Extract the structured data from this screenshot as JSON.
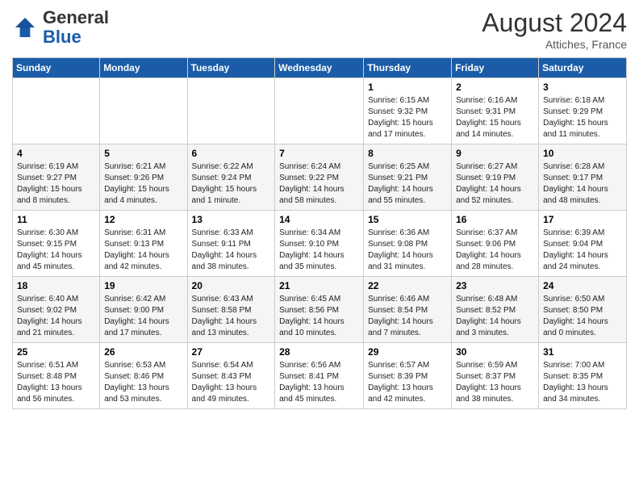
{
  "logo": {
    "general": "General",
    "blue": "Blue"
  },
  "title": "August 2024",
  "location": "Attiches, France",
  "weekdays": [
    "Sunday",
    "Monday",
    "Tuesday",
    "Wednesday",
    "Thursday",
    "Friday",
    "Saturday"
  ],
  "weeks": [
    [
      {
        "day": "",
        "info": ""
      },
      {
        "day": "",
        "info": ""
      },
      {
        "day": "",
        "info": ""
      },
      {
        "day": "",
        "info": ""
      },
      {
        "day": "1",
        "info": "Sunrise: 6:15 AM\nSunset: 9:32 PM\nDaylight: 15 hours\nand 17 minutes."
      },
      {
        "day": "2",
        "info": "Sunrise: 6:16 AM\nSunset: 9:31 PM\nDaylight: 15 hours\nand 14 minutes."
      },
      {
        "day": "3",
        "info": "Sunrise: 6:18 AM\nSunset: 9:29 PM\nDaylight: 15 hours\nand 11 minutes."
      }
    ],
    [
      {
        "day": "4",
        "info": "Sunrise: 6:19 AM\nSunset: 9:27 PM\nDaylight: 15 hours\nand 8 minutes."
      },
      {
        "day": "5",
        "info": "Sunrise: 6:21 AM\nSunset: 9:26 PM\nDaylight: 15 hours\nand 4 minutes."
      },
      {
        "day": "6",
        "info": "Sunrise: 6:22 AM\nSunset: 9:24 PM\nDaylight: 15 hours\nand 1 minute."
      },
      {
        "day": "7",
        "info": "Sunrise: 6:24 AM\nSunset: 9:22 PM\nDaylight: 14 hours\nand 58 minutes."
      },
      {
        "day": "8",
        "info": "Sunrise: 6:25 AM\nSunset: 9:21 PM\nDaylight: 14 hours\nand 55 minutes."
      },
      {
        "day": "9",
        "info": "Sunrise: 6:27 AM\nSunset: 9:19 PM\nDaylight: 14 hours\nand 52 minutes."
      },
      {
        "day": "10",
        "info": "Sunrise: 6:28 AM\nSunset: 9:17 PM\nDaylight: 14 hours\nand 48 minutes."
      }
    ],
    [
      {
        "day": "11",
        "info": "Sunrise: 6:30 AM\nSunset: 9:15 PM\nDaylight: 14 hours\nand 45 minutes."
      },
      {
        "day": "12",
        "info": "Sunrise: 6:31 AM\nSunset: 9:13 PM\nDaylight: 14 hours\nand 42 minutes."
      },
      {
        "day": "13",
        "info": "Sunrise: 6:33 AM\nSunset: 9:11 PM\nDaylight: 14 hours\nand 38 minutes."
      },
      {
        "day": "14",
        "info": "Sunrise: 6:34 AM\nSunset: 9:10 PM\nDaylight: 14 hours\nand 35 minutes."
      },
      {
        "day": "15",
        "info": "Sunrise: 6:36 AM\nSunset: 9:08 PM\nDaylight: 14 hours\nand 31 minutes."
      },
      {
        "day": "16",
        "info": "Sunrise: 6:37 AM\nSunset: 9:06 PM\nDaylight: 14 hours\nand 28 minutes."
      },
      {
        "day": "17",
        "info": "Sunrise: 6:39 AM\nSunset: 9:04 PM\nDaylight: 14 hours\nand 24 minutes."
      }
    ],
    [
      {
        "day": "18",
        "info": "Sunrise: 6:40 AM\nSunset: 9:02 PM\nDaylight: 14 hours\nand 21 minutes."
      },
      {
        "day": "19",
        "info": "Sunrise: 6:42 AM\nSunset: 9:00 PM\nDaylight: 14 hours\nand 17 minutes."
      },
      {
        "day": "20",
        "info": "Sunrise: 6:43 AM\nSunset: 8:58 PM\nDaylight: 14 hours\nand 13 minutes."
      },
      {
        "day": "21",
        "info": "Sunrise: 6:45 AM\nSunset: 8:56 PM\nDaylight: 14 hours\nand 10 minutes."
      },
      {
        "day": "22",
        "info": "Sunrise: 6:46 AM\nSunset: 8:54 PM\nDaylight: 14 hours\nand 7 minutes."
      },
      {
        "day": "23",
        "info": "Sunrise: 6:48 AM\nSunset: 8:52 PM\nDaylight: 14 hours\nand 3 minutes."
      },
      {
        "day": "24",
        "info": "Sunrise: 6:50 AM\nSunset: 8:50 PM\nDaylight: 14 hours\nand 0 minutes."
      }
    ],
    [
      {
        "day": "25",
        "info": "Sunrise: 6:51 AM\nSunset: 8:48 PM\nDaylight: 13 hours\nand 56 minutes."
      },
      {
        "day": "26",
        "info": "Sunrise: 6:53 AM\nSunset: 8:46 PM\nDaylight: 13 hours\nand 53 minutes."
      },
      {
        "day": "27",
        "info": "Sunrise: 6:54 AM\nSunset: 8:43 PM\nDaylight: 13 hours\nand 49 minutes."
      },
      {
        "day": "28",
        "info": "Sunrise: 6:56 AM\nSunset: 8:41 PM\nDaylight: 13 hours\nand 45 minutes."
      },
      {
        "day": "29",
        "info": "Sunrise: 6:57 AM\nSunset: 8:39 PM\nDaylight: 13 hours\nand 42 minutes."
      },
      {
        "day": "30",
        "info": "Sunrise: 6:59 AM\nSunset: 8:37 PM\nDaylight: 13 hours\nand 38 minutes."
      },
      {
        "day": "31",
        "info": "Sunrise: 7:00 AM\nSunset: 8:35 PM\nDaylight: 13 hours\nand 34 minutes."
      }
    ]
  ]
}
